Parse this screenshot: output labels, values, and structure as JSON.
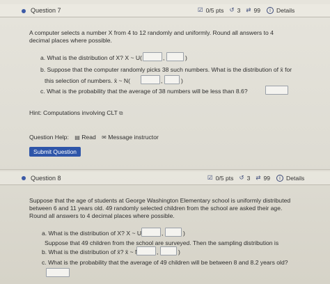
{
  "q7": {
    "title": "Question 7",
    "points": "0/5 pts",
    "retries": "3",
    "attempts": "99",
    "details": "Details",
    "prompt_l1": "A computer selects a number X from 4 to 12 randomly and uniformly. Round all answers to 4",
    "prompt_l2": "decimal places where possible.",
    "a": "a. What is the distribution of X? X ~ U(",
    "b_l1": "b. Suppose that the computer randomly picks 38 such numbers.  What is the distribution of x̄ for",
    "b_l2": "this selection of numbers. x̄ ~ N(",
    "c": "c. What is the probability that the average of 38 numbers will be less than 8.6?",
    "hint": "Hint: Computations involving CLT",
    "help_label": "Question Help:",
    "read_label": "Read",
    "message_label": "Message instructor",
    "submit_label": "Submit Question"
  },
  "q8": {
    "title": "Question 8",
    "points": "0/5 pts",
    "retries": "3",
    "attempts": "99",
    "details": "Details",
    "prompt_l1": "Suppose that the age of students at George Washington Elementary school is uniformly distributed",
    "prompt_l2": "between 6 and 11 years old. 49 randomly selected children from the school are asked their age.",
    "prompt_l3": "Round all answers to 4 decimal places where possible.",
    "a": "a. What is the distribution of X? X ~ U(",
    "mid": "Suppose that 49 children from the school are surveyed. Then the sampling distribution is",
    "b": "b. What is the distribution of x̄? x̄ ~ N(",
    "c": "c. What is the probability that the average of 49 children will be between 8 and 8.2 years old?"
  },
  "colors": {
    "accent": "#2e55a9",
    "link": "#3b55a0",
    "dot": "#3c5aa6"
  },
  "icons": [
    "checkbox-icon",
    "retry-icon",
    "attempts-icon",
    "info-icon",
    "external-link-icon",
    "book-icon",
    "mail-icon"
  ]
}
